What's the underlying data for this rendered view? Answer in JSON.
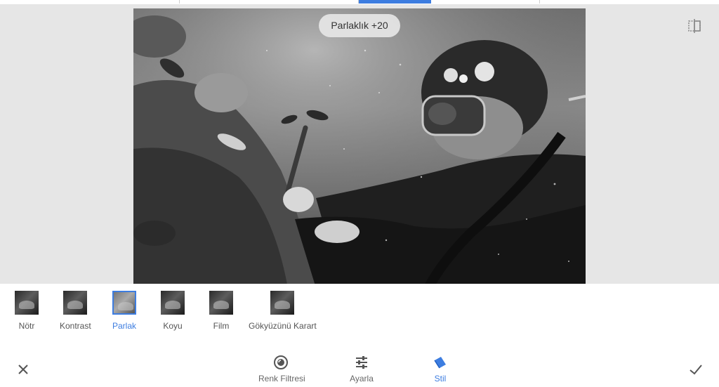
{
  "editor": {
    "adjustment_readout": "Parlaklık +20",
    "accent_color": "#3d7de0"
  },
  "styles": [
    {
      "label": "Nötr",
      "selected": false
    },
    {
      "label": "Kontrast",
      "selected": false
    },
    {
      "label": "Parlak",
      "selected": true
    },
    {
      "label": "Koyu",
      "selected": false
    },
    {
      "label": "Film",
      "selected": false
    },
    {
      "label": "Gökyüzünü Karart",
      "selected": false
    }
  ],
  "toolbar": {
    "cancel_icon": "close-icon",
    "apply_icon": "checkmark-icon",
    "tabs": [
      {
        "label": "Renk Filtresi",
        "icon": "color-filter-icon",
        "active": false
      },
      {
        "label": "Ayarla",
        "icon": "sliders-icon",
        "active": false
      },
      {
        "label": "Stil",
        "icon": "style-icon",
        "active": true
      }
    ]
  }
}
